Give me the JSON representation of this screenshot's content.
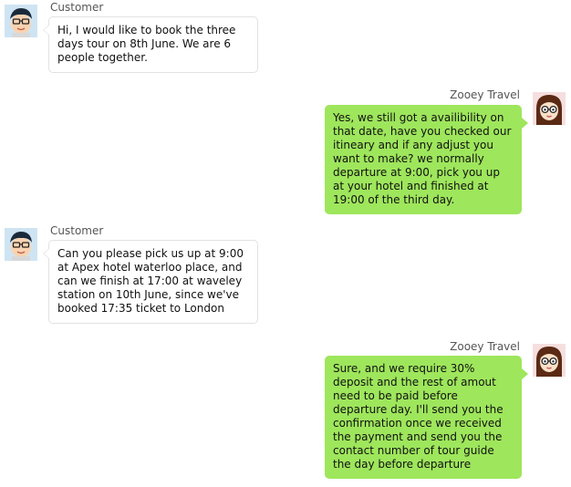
{
  "colors": {
    "agent_bubble": "#9ee65c",
    "customer_bubble": "#ffffff",
    "customer_bubble_border": "#e2e2e2"
  },
  "messages": [
    {
      "sender": "Customer",
      "side": "left",
      "avatar": "boy-avatar-icon",
      "text": "Hi, I would like to book the three days tour on 8th June. We are 6 people together."
    },
    {
      "sender": "Zooey Travel",
      "side": "right",
      "avatar": "girl-with-glasses-avatar-icon",
      "text": "Yes, we still got a availibility on that date, have you checked our itineary and if any adjust you want to make? we normally departure at 9:00, pick you up at your hotel and finished at 19:00 of the third day."
    },
    {
      "sender": "Customer",
      "side": "left",
      "avatar": "boy-avatar-icon",
      "text": "Can you please pick us up at 9:00 at Apex hotel waterloo place, and can we finish at 17:00 at waveley station on 10th June, since we've booked 17:35 ticket to London"
    },
    {
      "sender": "Zooey Travel",
      "side": "right",
      "avatar": "girl-with-glasses-avatar-icon",
      "text": "Sure, and we require 30% deposit and the rest of amout need to be paid before departure day. I'll send you the confirmation once we received the payment and send you the contact number of tour guide the day before departure"
    }
  ]
}
